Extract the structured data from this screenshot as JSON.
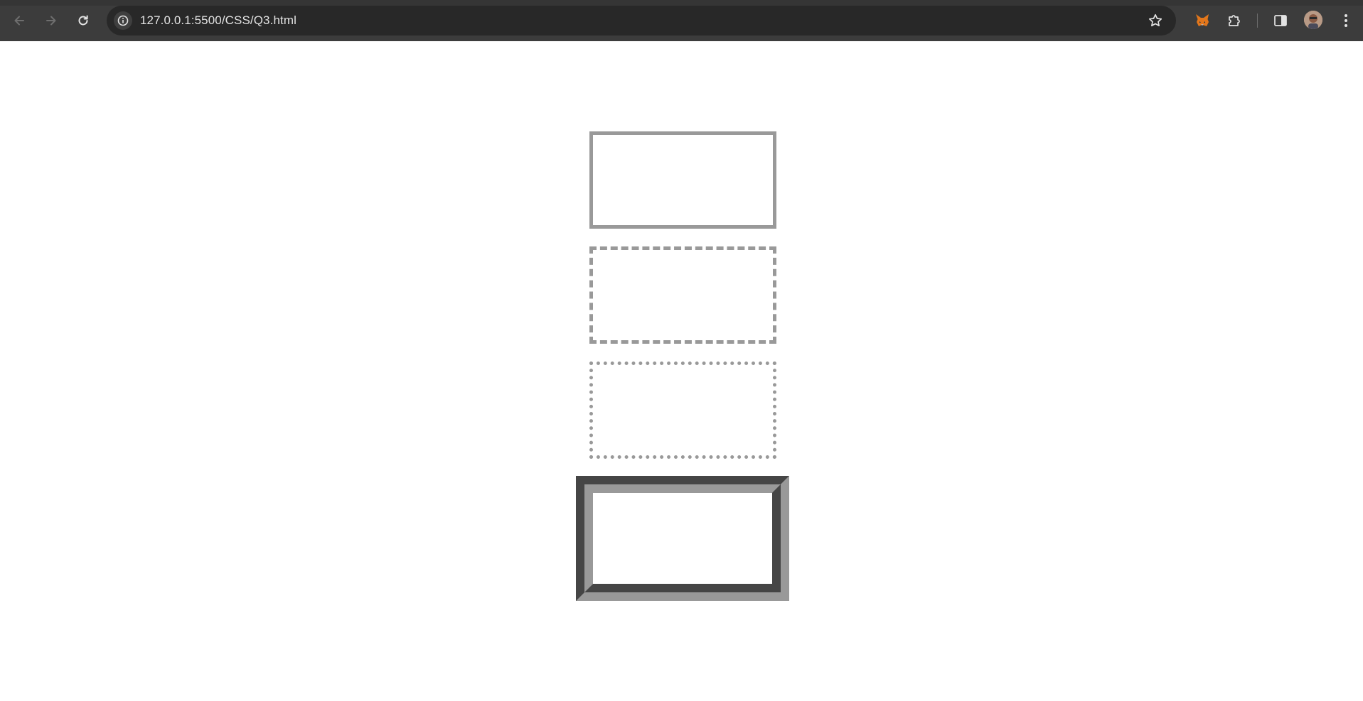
{
  "browser": {
    "url": "127.0.0.1:5500/CSS/Q3.html",
    "icons": {
      "back": "arrow-left-icon",
      "forward": "arrow-right-icon",
      "reload": "reload-icon",
      "site_info": "info-icon",
      "bookmark": "star-icon",
      "extension_metamask": "fox-icon",
      "extensions": "puzzle-icon",
      "side_panel": "side-panel-icon",
      "profile": "avatar",
      "menu": "kebab-menu-icon"
    }
  },
  "page": {
    "boxes": [
      {
        "style": "solid",
        "color": "#999999"
      },
      {
        "style": "dashed",
        "color": "#999999"
      },
      {
        "style": "dotted",
        "color": "#999999"
      },
      {
        "style": "groove",
        "color": "#999999"
      }
    ]
  }
}
